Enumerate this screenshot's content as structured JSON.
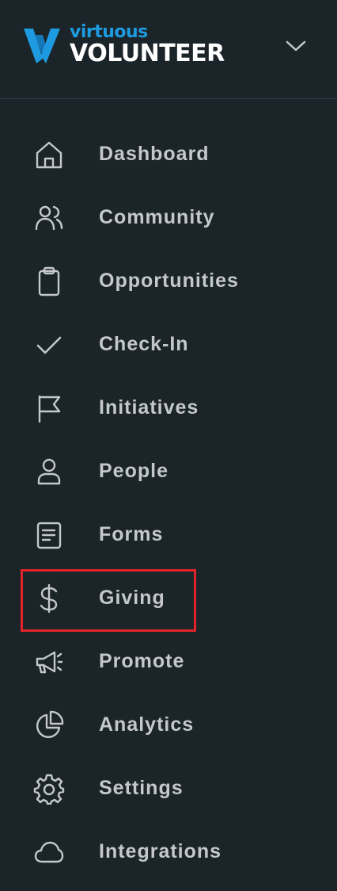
{
  "brand": {
    "small": "virtuous",
    "big": "VOLUNTEER",
    "accent": "#1e9be0"
  },
  "header": {
    "collapse_icon": "chevron-down-icon"
  },
  "nav": {
    "items": [
      {
        "label": "Dashboard",
        "icon": "home-icon"
      },
      {
        "label": "Community",
        "icon": "users-icon"
      },
      {
        "label": "Opportunities",
        "icon": "clipboard-icon"
      },
      {
        "label": "Check-In",
        "icon": "check-icon"
      },
      {
        "label": "Initiatives",
        "icon": "flag-icon"
      },
      {
        "label": "People",
        "icon": "user-icon"
      },
      {
        "label": "Forms",
        "icon": "form-icon"
      },
      {
        "label": "Giving",
        "icon": "dollar-icon"
      },
      {
        "label": "Promote",
        "icon": "megaphone-icon"
      },
      {
        "label": "Analytics",
        "icon": "pie-chart-icon"
      },
      {
        "label": "Settings",
        "icon": "gear-icon"
      },
      {
        "label": "Integrations",
        "icon": "cloud-icon"
      }
    ]
  },
  "highlight": {
    "target": "Giving",
    "color": "#e3232a"
  },
  "colors": {
    "background": "#1b2428",
    "text": "#c4c8ca",
    "icon": "#c4c8ca"
  }
}
